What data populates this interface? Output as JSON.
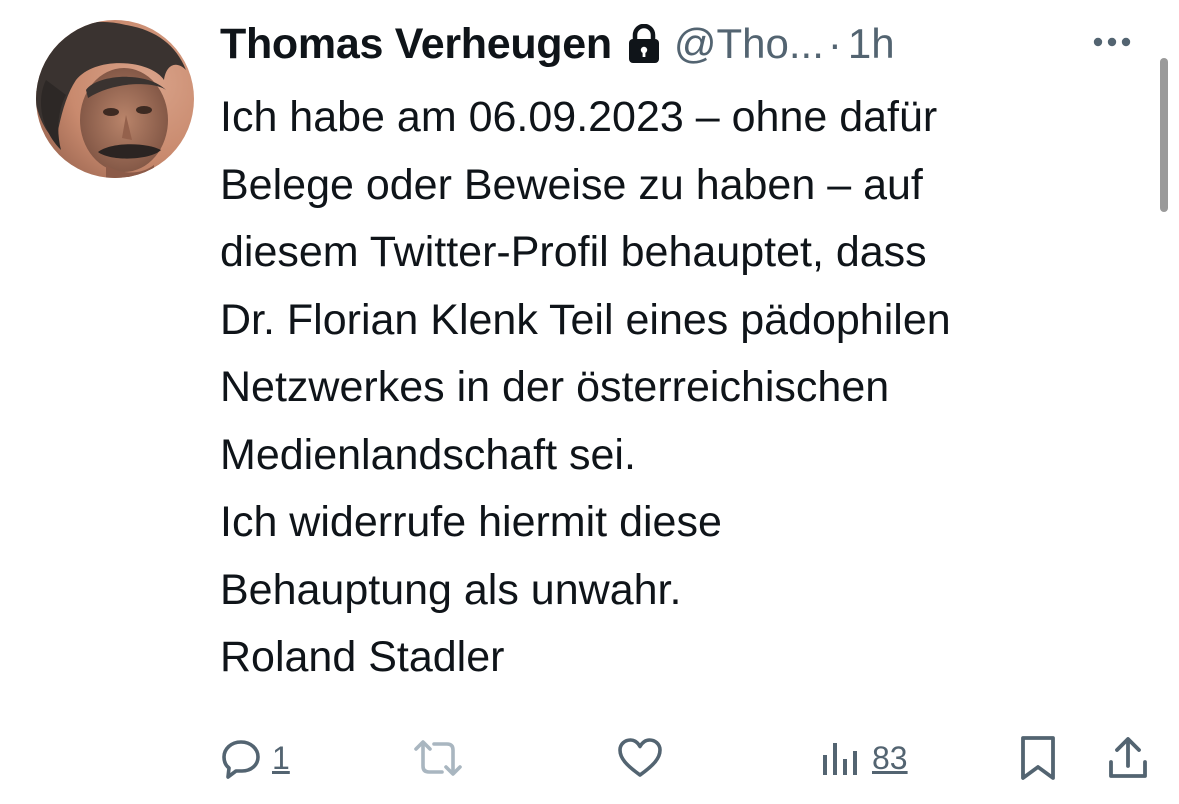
{
  "tweet": {
    "author": {
      "display_name": "Thomas Verheugen",
      "handle": "@Tho...",
      "protected_icon": "lock-icon",
      "avatar": "profile-photo"
    },
    "separator": "·",
    "time": "1h",
    "more_icon": "more-horizontal-icon",
    "text_lines": [
      "Ich habe am 06.09.2023 – ohne dafür",
      "Belege oder Beweise zu haben – auf",
      "diesem Twitter-Profil behauptet, dass",
      "Dr. Florian Klenk Teil eines pädophilen",
      "Netzwerkes in der österreichischen",
      "Medienlandschaft sei.",
      "Ich widerrufe hiermit diese",
      "Behauptung als unwahr.",
      "Roland Stadler"
    ],
    "actions": {
      "reply": {
        "icon": "reply-icon",
        "count": "1"
      },
      "retweet": {
        "icon": "retweet-icon",
        "count": ""
      },
      "like": {
        "icon": "heart-icon",
        "count": ""
      },
      "views": {
        "icon": "views-chart-icon",
        "count": "83"
      },
      "bookmark": {
        "icon": "bookmark-icon"
      },
      "share": {
        "icon": "share-icon"
      }
    }
  },
  "colors": {
    "text_primary": "#0f1419",
    "text_secondary": "#536471",
    "retweet_disabled": "#a9b6c0",
    "background": "#ffffff"
  }
}
